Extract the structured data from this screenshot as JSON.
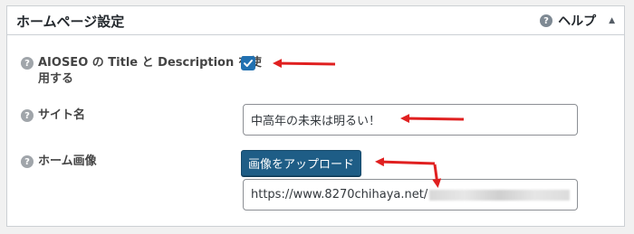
{
  "panel": {
    "title": "ホームページ設定",
    "help_label": "ヘルプ",
    "help_icon": "?",
    "collapse_icon": "▲"
  },
  "fields": {
    "aioseo": {
      "label_line1": "AIOSEO の Title と Description を使",
      "label_line2": "用する",
      "checked": true
    },
    "site_name": {
      "label": "サイト名",
      "value": "中高年の未来は明るい！"
    },
    "home_image": {
      "label": "ホーム画像",
      "button_label": "画像をアップロード",
      "url_value": "https://www.8270chihaya.net/"
    }
  },
  "annotation_color": "#e02020",
  "accent_color": "#2271b1"
}
